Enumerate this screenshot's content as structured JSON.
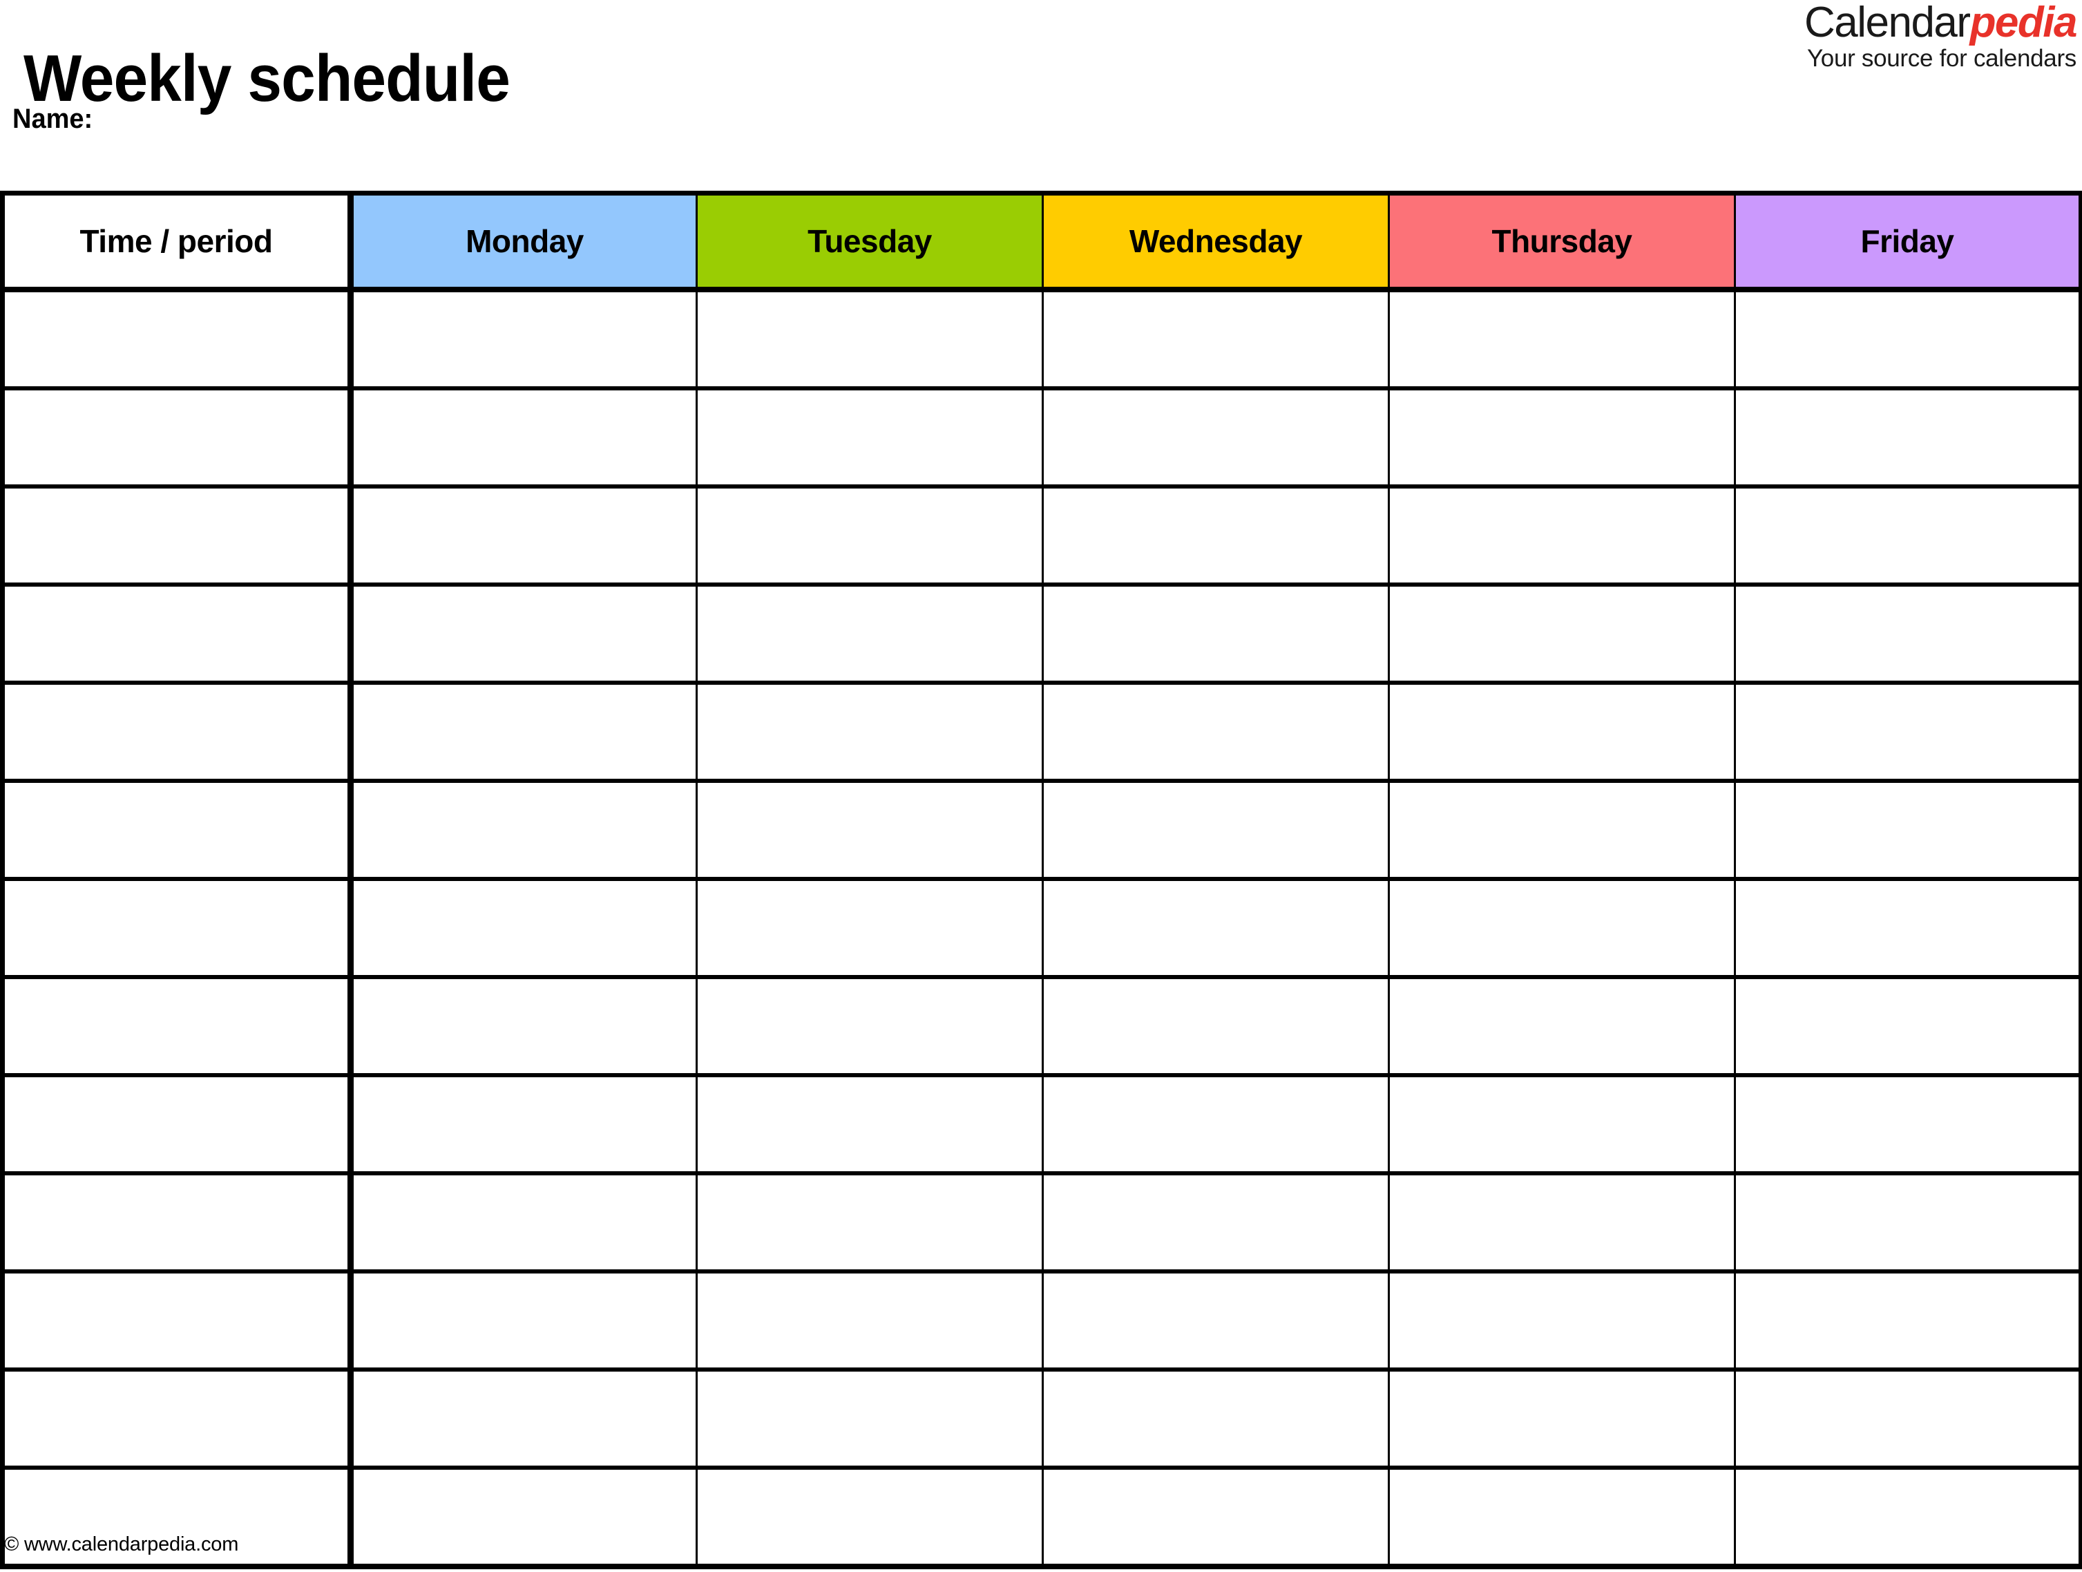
{
  "document": {
    "title": "Weekly schedule",
    "name_label": "Name:"
  },
  "logo": {
    "brand_part1": "Calendar",
    "brand_part2": "pedia",
    "tagline": "Your source for calendars",
    "brand_part1_color": "#1a1a1a",
    "brand_part2_color": "#e8322a"
  },
  "table": {
    "columns": [
      {
        "label": "Time / period",
        "bg": "#ffffff"
      },
      {
        "label": "Monday",
        "bg": "#93c7fd"
      },
      {
        "label": "Tuesday",
        "bg": "#9acd03"
      },
      {
        "label": "Wednesday",
        "bg": "#ffcc00"
      },
      {
        "label": "Thursday",
        "bg": "#fc7278"
      },
      {
        "label": "Friday",
        "bg": "#cb99fd"
      }
    ],
    "row_count": 13,
    "rows": [
      [
        "",
        "",
        "",
        "",
        "",
        ""
      ],
      [
        "",
        "",
        "",
        "",
        "",
        ""
      ],
      [
        "",
        "",
        "",
        "",
        "",
        ""
      ],
      [
        "",
        "",
        "",
        "",
        "",
        ""
      ],
      [
        "",
        "",
        "",
        "",
        "",
        ""
      ],
      [
        "",
        "",
        "",
        "",
        "",
        ""
      ],
      [
        "",
        "",
        "",
        "",
        "",
        ""
      ],
      [
        "",
        "",
        "",
        "",
        "",
        ""
      ],
      [
        "",
        "",
        "",
        "",
        "",
        ""
      ],
      [
        "",
        "",
        "",
        "",
        "",
        ""
      ],
      [
        "",
        "",
        "",
        "",
        "",
        ""
      ],
      [
        "",
        "",
        "",
        "",
        "",
        ""
      ],
      [
        "",
        "",
        "",
        "",
        "",
        ""
      ]
    ],
    "border_color": "#000000",
    "cell_background": "#ffffff"
  },
  "footer": {
    "copyright": "© www.calendarpedia.com"
  }
}
